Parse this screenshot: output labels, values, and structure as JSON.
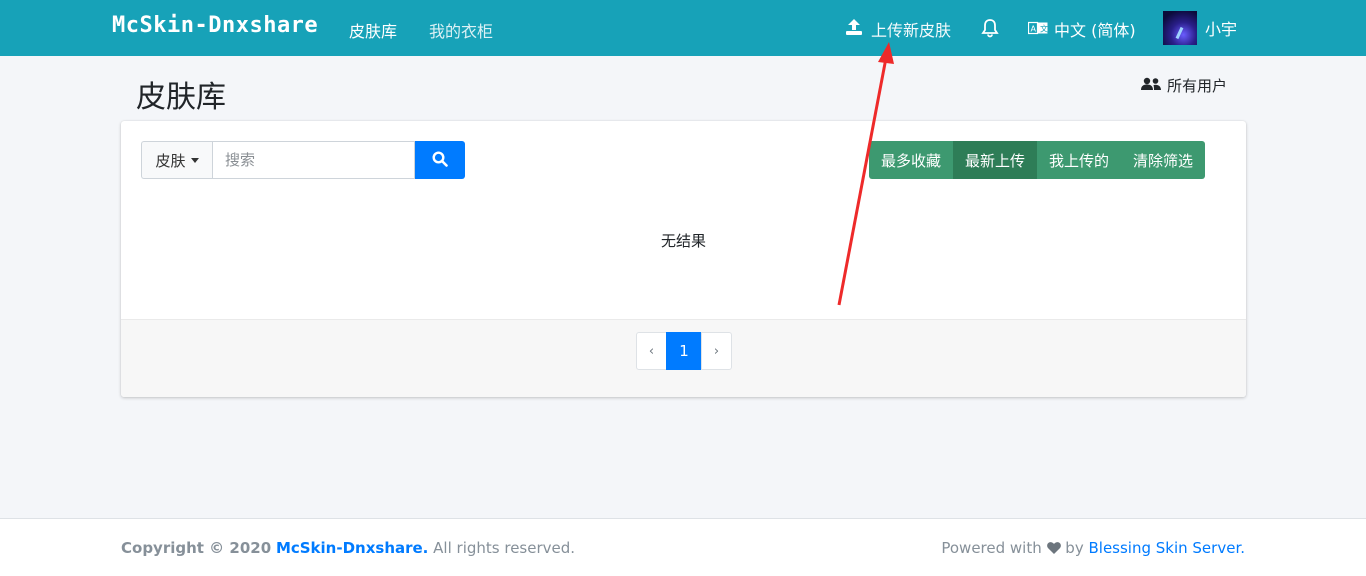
{
  "navbar": {
    "brand": "McSkin-Dnxshare",
    "links": [
      "皮肤库",
      "我的衣柜"
    ],
    "upload_label": "上传新皮肤",
    "language_label": "中文 (简体)",
    "username": "小宇",
    "color": "#17a2b8"
  },
  "header": {
    "title": "皮肤库",
    "all_users_label": "所有用户"
  },
  "search": {
    "type_label": "皮肤",
    "placeholder": "搜索",
    "value": ""
  },
  "filters": {
    "buttons": [
      "最多收藏",
      "最新上传",
      "我上传的",
      "清除筛选"
    ],
    "active": "最新上传"
  },
  "results": {
    "empty_text": "无结果"
  },
  "pagination": {
    "prev": "‹",
    "current": "1",
    "next": "›"
  },
  "footer": {
    "copyright_prefix": "Copyright © 2020",
    "site_name": "McSkin-Dnxshare.",
    "rights": "All rights reserved.",
    "powered_prefix": "Powered with",
    "powered_by": "by",
    "server_name": "Blessing Skin Server."
  },
  "icons": {
    "upload": "upload-icon",
    "bell": "bell-icon",
    "language": "language-icon",
    "users": "users-icon",
    "search": "search-icon",
    "heart": "heart-icon"
  }
}
